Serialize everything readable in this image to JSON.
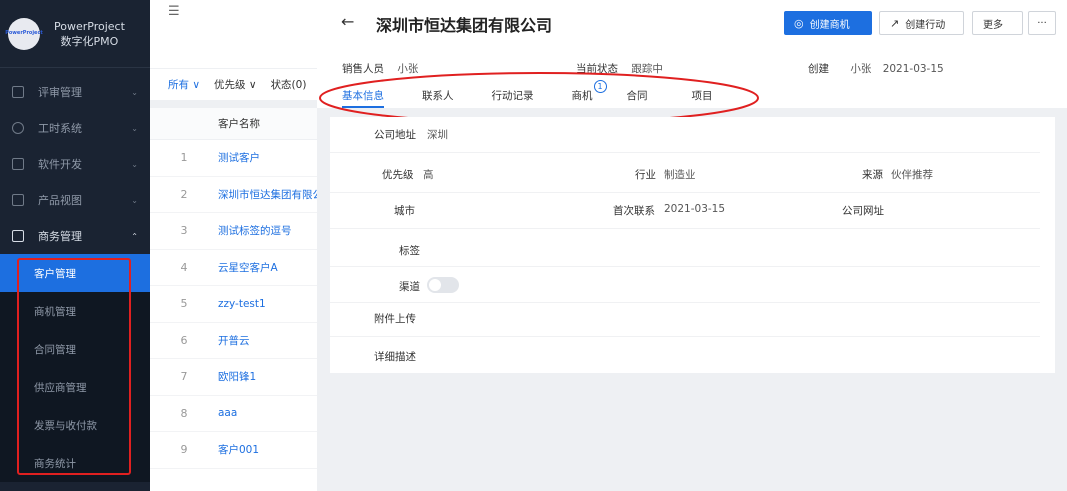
{
  "app": {
    "logo_text": "PowerProject",
    "name_line1": "PowerProject",
    "name_line2": "数字化PMO"
  },
  "sidebar": {
    "items": [
      {
        "label": "评审管理",
        "chev": "⌄"
      },
      {
        "label": "工时系统",
        "chev": "⌄"
      },
      {
        "label": "软件开发",
        "chev": "⌄"
      },
      {
        "label": "产品视图",
        "chev": "⌄"
      },
      {
        "label": "商务管理",
        "chev": "⌃"
      }
    ],
    "submenu": [
      {
        "label": "客户管理",
        "active": true
      },
      {
        "label": "商机管理"
      },
      {
        "label": "合同管理"
      },
      {
        "label": "供应商管理"
      },
      {
        "label": "发票与收付款"
      },
      {
        "label": "商务统计"
      }
    ]
  },
  "list": {
    "collapse_icon": "☰",
    "filters": {
      "all": "所有 ∨",
      "priority": "优先级 ∨",
      "status": "状态(0)"
    },
    "header": {
      "name": "客户名称"
    },
    "rows": [
      {
        "num": "1",
        "name": "测试客户"
      },
      {
        "num": "2",
        "name": "深圳市恒达集团有限公"
      },
      {
        "num": "3",
        "name": "测试标签的逗号"
      },
      {
        "num": "4",
        "name": "云星空客户A"
      },
      {
        "num": "5",
        "name": "zzy-test1"
      },
      {
        "num": "6",
        "name": "开普云"
      },
      {
        "num": "7",
        "name": "欧阳锋1"
      },
      {
        "num": "8",
        "name": "aaa"
      },
      {
        "num": "9",
        "name": "客户001"
      }
    ]
  },
  "detail": {
    "back": "←",
    "title": "深圳市恒达集团有限公司",
    "buttons": {
      "create_opportunity": "创建商机",
      "create_action": "创建行动",
      "more": "更多",
      "ellipsis": "···"
    },
    "meta": {
      "sales_key": "销售人员",
      "sales_val": "小张",
      "status_key": "当前状态",
      "status_val": "跟踪中",
      "created_key": "创建",
      "created_by": "小张",
      "created_date": "2021-03-15"
    },
    "tabs": [
      {
        "label": "基本信息",
        "active": true
      },
      {
        "label": "联系人"
      },
      {
        "label": "行动记录"
      },
      {
        "label": "商机",
        "badge": "1"
      },
      {
        "label": "合同"
      },
      {
        "label": "项目"
      }
    ],
    "fields": {
      "address_key": "公司地址",
      "address_val": "深圳",
      "priority_key": "优先级",
      "priority_val": "高",
      "industry_key": "行业",
      "industry_val": "制造业",
      "source_key": "来源",
      "source_val": "伙伴推荐",
      "city_key": "城市",
      "first_contact_key": "首次联系",
      "first_contact_val": "2021-03-15",
      "website_key": "公司网址",
      "tags_key": "标签",
      "channel_key": "渠道",
      "attachment_key": "附件上传",
      "description_key": "详细描述"
    }
  },
  "colors": {
    "accent": "#1d6fe0",
    "sidebar_bg": "#1a2332",
    "annotation": "#e02020"
  }
}
